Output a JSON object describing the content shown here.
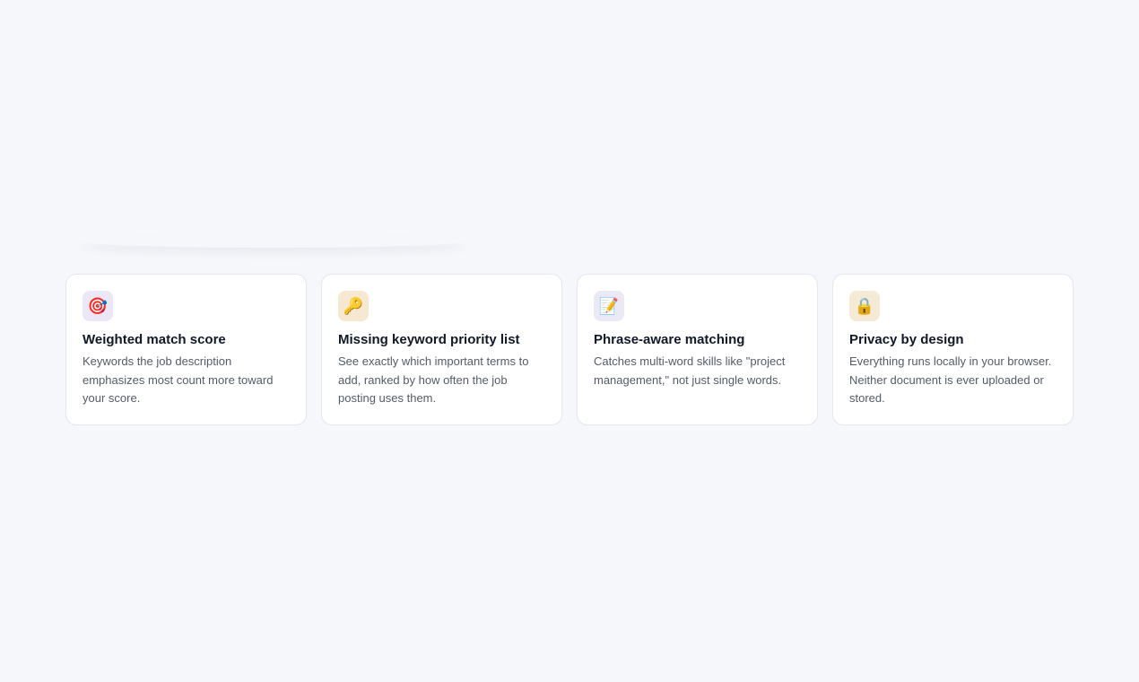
{
  "features": [
    {
      "icon": "target-icon",
      "glyph": "🎯",
      "icon_bg": "#ebe7f6",
      "title": "Weighted match score",
      "description": "Keywords the job description emphasizes most count more toward your score."
    },
    {
      "icon": "key-icon",
      "glyph": "🔑",
      "icon_bg": "#f7e8d2",
      "title": "Missing keyword priority list",
      "description": "See exactly which important terms to add, ranked by how often the job posting uses them."
    },
    {
      "icon": "memo-icon",
      "glyph": "📝",
      "icon_bg": "#ebe9f5",
      "title": "Phrase-aware matching",
      "description": "Catches multi-word skills like \"project management,\" not just single words."
    },
    {
      "icon": "lock-icon",
      "glyph": "🔒",
      "icon_bg": "#f5ead6",
      "title": "Privacy by design",
      "description": "Everything runs locally in your browser. Neither document is ever uploaded or stored."
    }
  ]
}
